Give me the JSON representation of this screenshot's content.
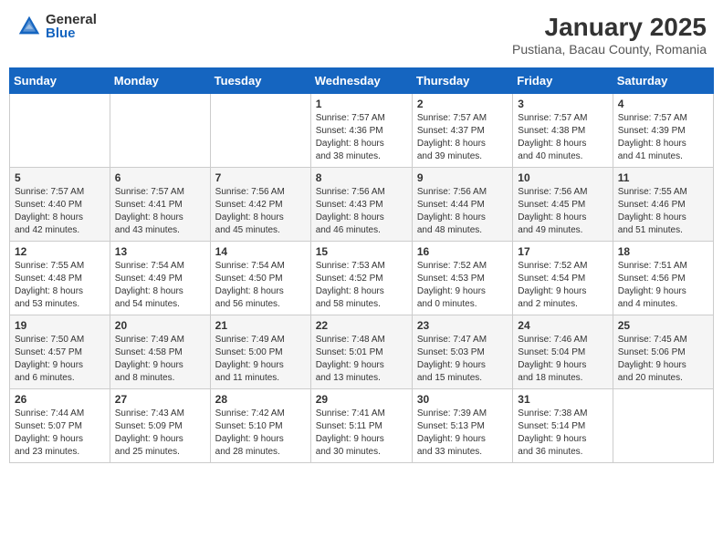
{
  "header": {
    "logo_general": "General",
    "logo_blue": "Blue",
    "title": "January 2025",
    "subtitle": "Pustiana, Bacau County, Romania"
  },
  "days_of_week": [
    "Sunday",
    "Monday",
    "Tuesday",
    "Wednesday",
    "Thursday",
    "Friday",
    "Saturday"
  ],
  "weeks": [
    [
      {
        "day": "",
        "info": ""
      },
      {
        "day": "",
        "info": ""
      },
      {
        "day": "",
        "info": ""
      },
      {
        "day": "1",
        "info": "Sunrise: 7:57 AM\nSunset: 4:36 PM\nDaylight: 8 hours\nand 38 minutes."
      },
      {
        "day": "2",
        "info": "Sunrise: 7:57 AM\nSunset: 4:37 PM\nDaylight: 8 hours\nand 39 minutes."
      },
      {
        "day": "3",
        "info": "Sunrise: 7:57 AM\nSunset: 4:38 PM\nDaylight: 8 hours\nand 40 minutes."
      },
      {
        "day": "4",
        "info": "Sunrise: 7:57 AM\nSunset: 4:39 PM\nDaylight: 8 hours\nand 41 minutes."
      }
    ],
    [
      {
        "day": "5",
        "info": "Sunrise: 7:57 AM\nSunset: 4:40 PM\nDaylight: 8 hours\nand 42 minutes."
      },
      {
        "day": "6",
        "info": "Sunrise: 7:57 AM\nSunset: 4:41 PM\nDaylight: 8 hours\nand 43 minutes."
      },
      {
        "day": "7",
        "info": "Sunrise: 7:56 AM\nSunset: 4:42 PM\nDaylight: 8 hours\nand 45 minutes."
      },
      {
        "day": "8",
        "info": "Sunrise: 7:56 AM\nSunset: 4:43 PM\nDaylight: 8 hours\nand 46 minutes."
      },
      {
        "day": "9",
        "info": "Sunrise: 7:56 AM\nSunset: 4:44 PM\nDaylight: 8 hours\nand 48 minutes."
      },
      {
        "day": "10",
        "info": "Sunrise: 7:56 AM\nSunset: 4:45 PM\nDaylight: 8 hours\nand 49 minutes."
      },
      {
        "day": "11",
        "info": "Sunrise: 7:55 AM\nSunset: 4:46 PM\nDaylight: 8 hours\nand 51 minutes."
      }
    ],
    [
      {
        "day": "12",
        "info": "Sunrise: 7:55 AM\nSunset: 4:48 PM\nDaylight: 8 hours\nand 53 minutes."
      },
      {
        "day": "13",
        "info": "Sunrise: 7:54 AM\nSunset: 4:49 PM\nDaylight: 8 hours\nand 54 minutes."
      },
      {
        "day": "14",
        "info": "Sunrise: 7:54 AM\nSunset: 4:50 PM\nDaylight: 8 hours\nand 56 minutes."
      },
      {
        "day": "15",
        "info": "Sunrise: 7:53 AM\nSunset: 4:52 PM\nDaylight: 8 hours\nand 58 minutes."
      },
      {
        "day": "16",
        "info": "Sunrise: 7:52 AM\nSunset: 4:53 PM\nDaylight: 9 hours\nand 0 minutes."
      },
      {
        "day": "17",
        "info": "Sunrise: 7:52 AM\nSunset: 4:54 PM\nDaylight: 9 hours\nand 2 minutes."
      },
      {
        "day": "18",
        "info": "Sunrise: 7:51 AM\nSunset: 4:56 PM\nDaylight: 9 hours\nand 4 minutes."
      }
    ],
    [
      {
        "day": "19",
        "info": "Sunrise: 7:50 AM\nSunset: 4:57 PM\nDaylight: 9 hours\nand 6 minutes."
      },
      {
        "day": "20",
        "info": "Sunrise: 7:49 AM\nSunset: 4:58 PM\nDaylight: 9 hours\nand 8 minutes."
      },
      {
        "day": "21",
        "info": "Sunrise: 7:49 AM\nSunset: 5:00 PM\nDaylight: 9 hours\nand 11 minutes."
      },
      {
        "day": "22",
        "info": "Sunrise: 7:48 AM\nSunset: 5:01 PM\nDaylight: 9 hours\nand 13 minutes."
      },
      {
        "day": "23",
        "info": "Sunrise: 7:47 AM\nSunset: 5:03 PM\nDaylight: 9 hours\nand 15 minutes."
      },
      {
        "day": "24",
        "info": "Sunrise: 7:46 AM\nSunset: 5:04 PM\nDaylight: 9 hours\nand 18 minutes."
      },
      {
        "day": "25",
        "info": "Sunrise: 7:45 AM\nSunset: 5:06 PM\nDaylight: 9 hours\nand 20 minutes."
      }
    ],
    [
      {
        "day": "26",
        "info": "Sunrise: 7:44 AM\nSunset: 5:07 PM\nDaylight: 9 hours\nand 23 minutes."
      },
      {
        "day": "27",
        "info": "Sunrise: 7:43 AM\nSunset: 5:09 PM\nDaylight: 9 hours\nand 25 minutes."
      },
      {
        "day": "28",
        "info": "Sunrise: 7:42 AM\nSunset: 5:10 PM\nDaylight: 9 hours\nand 28 minutes."
      },
      {
        "day": "29",
        "info": "Sunrise: 7:41 AM\nSunset: 5:11 PM\nDaylight: 9 hours\nand 30 minutes."
      },
      {
        "day": "30",
        "info": "Sunrise: 7:39 AM\nSunset: 5:13 PM\nDaylight: 9 hours\nand 33 minutes."
      },
      {
        "day": "31",
        "info": "Sunrise: 7:38 AM\nSunset: 5:14 PM\nDaylight: 9 hours\nand 36 minutes."
      },
      {
        "day": "",
        "info": ""
      }
    ]
  ]
}
